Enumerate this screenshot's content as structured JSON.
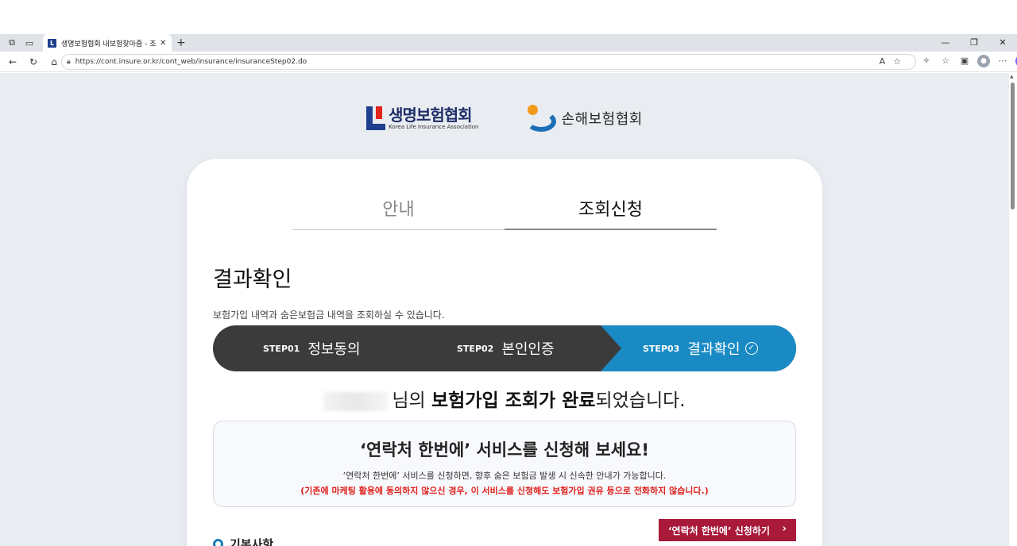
{
  "browser": {
    "tab_title": "생명보험협회 내보험찾아줌 - 조회",
    "tab_favicon": "L",
    "url": "https://cont.insure.or.kr/cont_web/insurance/insuranceStep02.do"
  },
  "logos": {
    "life_name": "생명보험협회",
    "life_sub": "Korea Life Insurance Association",
    "nonlife_name": "손해보험협회"
  },
  "tabs": {
    "guide": "안내",
    "apply": "조회신청"
  },
  "page": {
    "title": "결과확인",
    "description": "보험가입 내역과 숨은보험금 내역을 조회하실 수 있습니다."
  },
  "steps": [
    {
      "no": "STEP01",
      "name": "정보동의"
    },
    {
      "no": "STEP02",
      "name": "본인인증"
    },
    {
      "no": "STEP03",
      "name": "결과확인"
    }
  ],
  "complete": {
    "suffix_a": "님의 ",
    "bold": "보험가입 조회가 완료",
    "suffix_b": "되었습니다."
  },
  "promo": {
    "title": "‘연락처 한번에’ 서비스를 신청해 보세요!",
    "desc": "‘연락처 한번에’ 서비스를 신청하면, 향후 숨은 보험금 발생 시 신속한 안내가 가능합니다.",
    "warn": "(기존에 마케팅 활용에 동의하지 않으신 경우, 이 서비스를 신청해도 보험가입 권유 등으로 전화하지 않습니다.)"
  },
  "apply_button": "‘연락처 한번에’ 신청하기",
  "section_label": "기본사항",
  "colors": {
    "step_dark": "#3b3b3b",
    "step_active": "#1a8ac4",
    "apply_button": "#a8193a",
    "warn": "#e0201b"
  }
}
